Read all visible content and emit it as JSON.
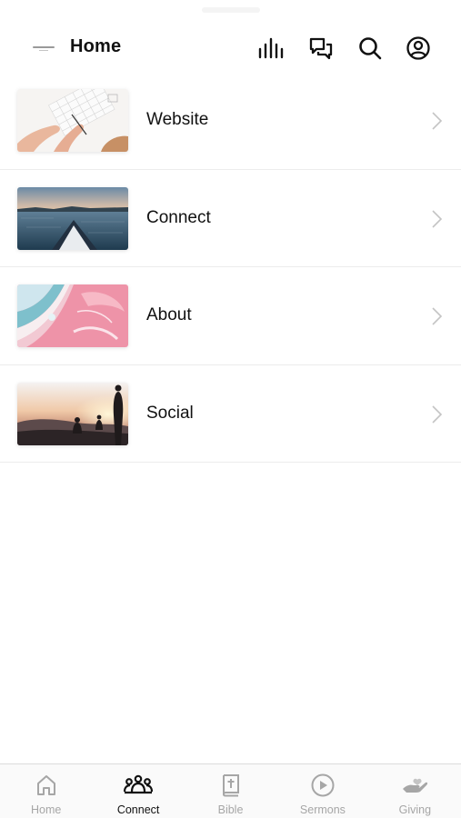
{
  "header": {
    "title": "Home",
    "icons": [
      "audio-bars-icon",
      "chat-bubbles-icon",
      "search-icon",
      "account-icon"
    ]
  },
  "list": {
    "items": [
      {
        "label": "Website",
        "thumbnail": "hands-typing-on-keyboard-photo"
      },
      {
        "label": "Connect",
        "thumbnail": "kayak-on-lake-sunset-photo"
      },
      {
        "label": "About",
        "thumbnail": "pink-marble-abstract-photo"
      },
      {
        "label": "Social",
        "thumbnail": "people-on-hill-at-sunset-photo"
      }
    ]
  },
  "tabbar": {
    "active": "Connect",
    "tabs": [
      {
        "label": "Home",
        "icon": "home-icon"
      },
      {
        "label": "Connect",
        "icon": "people-group-icon"
      },
      {
        "label": "Bible",
        "icon": "bible-icon"
      },
      {
        "label": "Sermons",
        "icon": "play-circle-icon"
      },
      {
        "label": "Giving",
        "icon": "giving-hand-icon"
      }
    ]
  },
  "colors": {
    "text": "#111111",
    "inactive_tab": "#a6a6a6",
    "divider": "#ececec",
    "chevron": "#c4c4c4"
  }
}
